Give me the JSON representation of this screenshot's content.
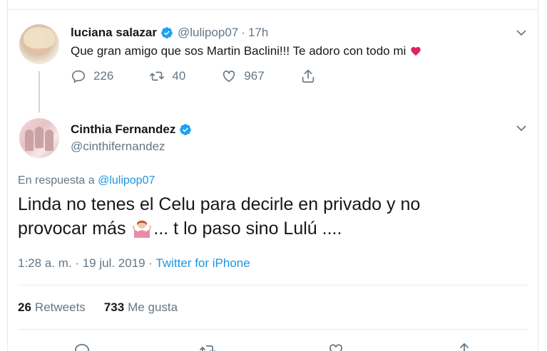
{
  "tweet1": {
    "name": "luciana salazar",
    "handle": "@lulipop07",
    "separator": "·",
    "time": "17h",
    "text": "Que gran amigo que sos Martin Baclini!!! Te adoro con todo mi",
    "emoji": "red-heart-icon",
    "replies": "226",
    "retweets": "40",
    "likes": "967"
  },
  "tweet2": {
    "name": "Cinthia Fernandez",
    "handle": "@cinthifernandez",
    "reply_prefix": "En respuesta a ",
    "reply_mention": "@lulipop07",
    "text_line1": "Linda no tenes el Celu para decirle en privado y no",
    "text_line2_a": "provocar más ",
    "text_line2_b": "... t lo paso sino Lulú ....",
    "emoji": "person-shrugging-icon",
    "timestamp": "1:28 a. m. · 19 jul. 2019 · ",
    "source": "Twitter for iPhone",
    "retweets_count": "26",
    "retweets_label": "Retweets",
    "likes_count": "733",
    "likes_label": "Me gusta"
  },
  "colors": {
    "verified": "#1da1f2",
    "link": "#1b95e0",
    "muted": "#657786",
    "heart": "#e0245e"
  }
}
